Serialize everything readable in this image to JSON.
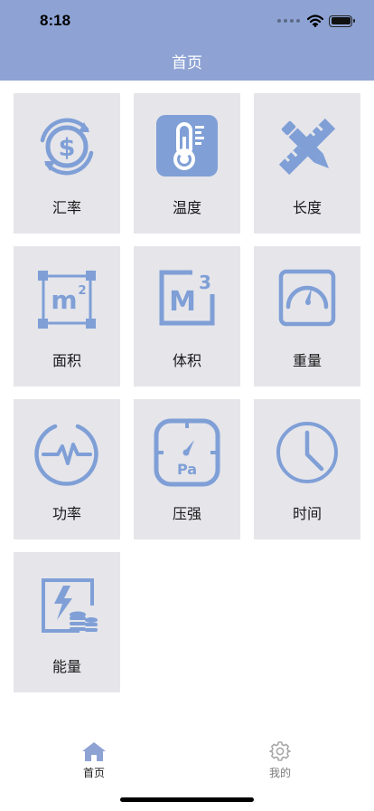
{
  "status_bar": {
    "time": "8:18"
  },
  "nav": {
    "title": "首页"
  },
  "tiles": [
    {
      "label": "汇率",
      "icon": "currency-exchange-icon"
    },
    {
      "label": "温度",
      "icon": "thermometer-icon"
    },
    {
      "label": "长度",
      "icon": "ruler-pencil-icon"
    },
    {
      "label": "面积",
      "icon": "area-m2-icon"
    },
    {
      "label": "体积",
      "icon": "volume-m3-icon"
    },
    {
      "label": "重量",
      "icon": "weight-scale-icon"
    },
    {
      "label": "功率",
      "icon": "power-pulse-icon"
    },
    {
      "label": "压强",
      "icon": "pressure-gauge-icon"
    },
    {
      "label": "时间",
      "icon": "clock-icon"
    },
    {
      "label": "能量",
      "icon": "energy-icon"
    }
  ],
  "icon_text": {
    "area_unit": "m",
    "area_exp": "2",
    "volume_unit": "M",
    "volume_exp": "3",
    "pressure_unit": "Pa"
  },
  "tabbar": {
    "home_label": "首页",
    "mine_label": "我的"
  },
  "colors": {
    "accent": "#8ea3d4",
    "tile_bg": "#e5e5ea",
    "icon": "#7f9fd6",
    "tab_active": "#8ea3d4",
    "tab_inactive": "#a8a8a8"
  }
}
